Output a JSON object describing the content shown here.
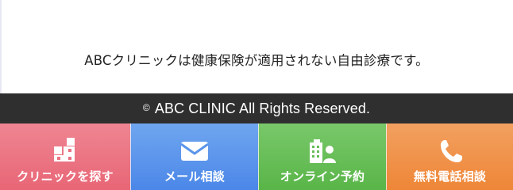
{
  "notice": {
    "text": "ABCクリニックは健康保険が適用されない自由診療です。"
  },
  "footer": {
    "copyright_symbol": "©",
    "text": "ABC CLINIC All Rights Reserved."
  },
  "nav": {
    "items": [
      {
        "label": "クリニックを探す",
        "icon": "building-icon",
        "color": "#e86676"
      },
      {
        "label": "メール相談",
        "icon": "mail-icon",
        "color": "#4b87e8"
      },
      {
        "label": "オンライン予約",
        "icon": "building-person-icon",
        "color": "#59b548"
      },
      {
        "label": "無料電話相談",
        "icon": "phone-icon",
        "color": "#ee8637"
      }
    ]
  }
}
